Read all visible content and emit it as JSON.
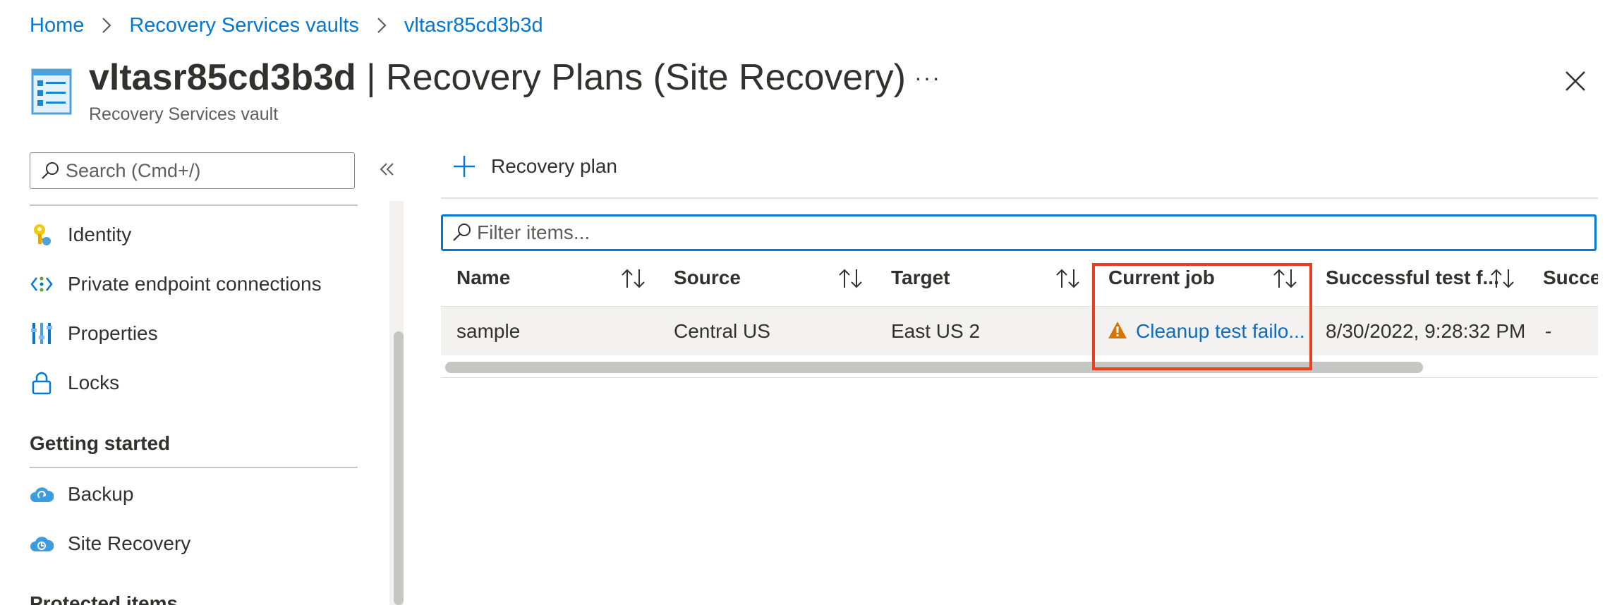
{
  "breadcrumb": {
    "items": [
      "Home",
      "Recovery Services vaults",
      "vltasr85cd3b3d"
    ]
  },
  "header": {
    "title_bold": "vltasr85cd3b3d",
    "title_rest": " | Recovery Plans (Site Recovery)",
    "subtitle": "Recovery Services vault",
    "more_label": "···"
  },
  "sidebar": {
    "search_placeholder": "Search (Cmd+/)",
    "items": [
      {
        "label": "Identity",
        "icon": "key-icon"
      },
      {
        "label": "Private endpoint connections",
        "icon": "endpoint-icon"
      },
      {
        "label": "Properties",
        "icon": "properties-icon"
      },
      {
        "label": "Locks",
        "icon": "lock-icon"
      }
    ],
    "sections": [
      {
        "title": "Getting started",
        "items": [
          {
            "label": "Backup",
            "icon": "backup-cloud-icon"
          },
          {
            "label": "Site Recovery",
            "icon": "site-recovery-cloud-icon"
          }
        ]
      },
      {
        "title": "Protected items",
        "items": []
      }
    ]
  },
  "toolbar": {
    "add_label": "Recovery plan"
  },
  "filter": {
    "placeholder": "Filter items..."
  },
  "table": {
    "columns": [
      "Name",
      "Source",
      "Target",
      "Current job",
      "Successful test f...",
      "Succe"
    ],
    "rows": [
      {
        "name": "sample",
        "source": "Central US",
        "target": "East US 2",
        "current_job": "Cleanup test failo...",
        "successful_test": "8/30/2022, 9:28:32 PM",
        "successful": "-"
      }
    ]
  },
  "colors": {
    "accent": "#0078d4",
    "highlight": "#e8401e",
    "warning": "#d47500"
  }
}
